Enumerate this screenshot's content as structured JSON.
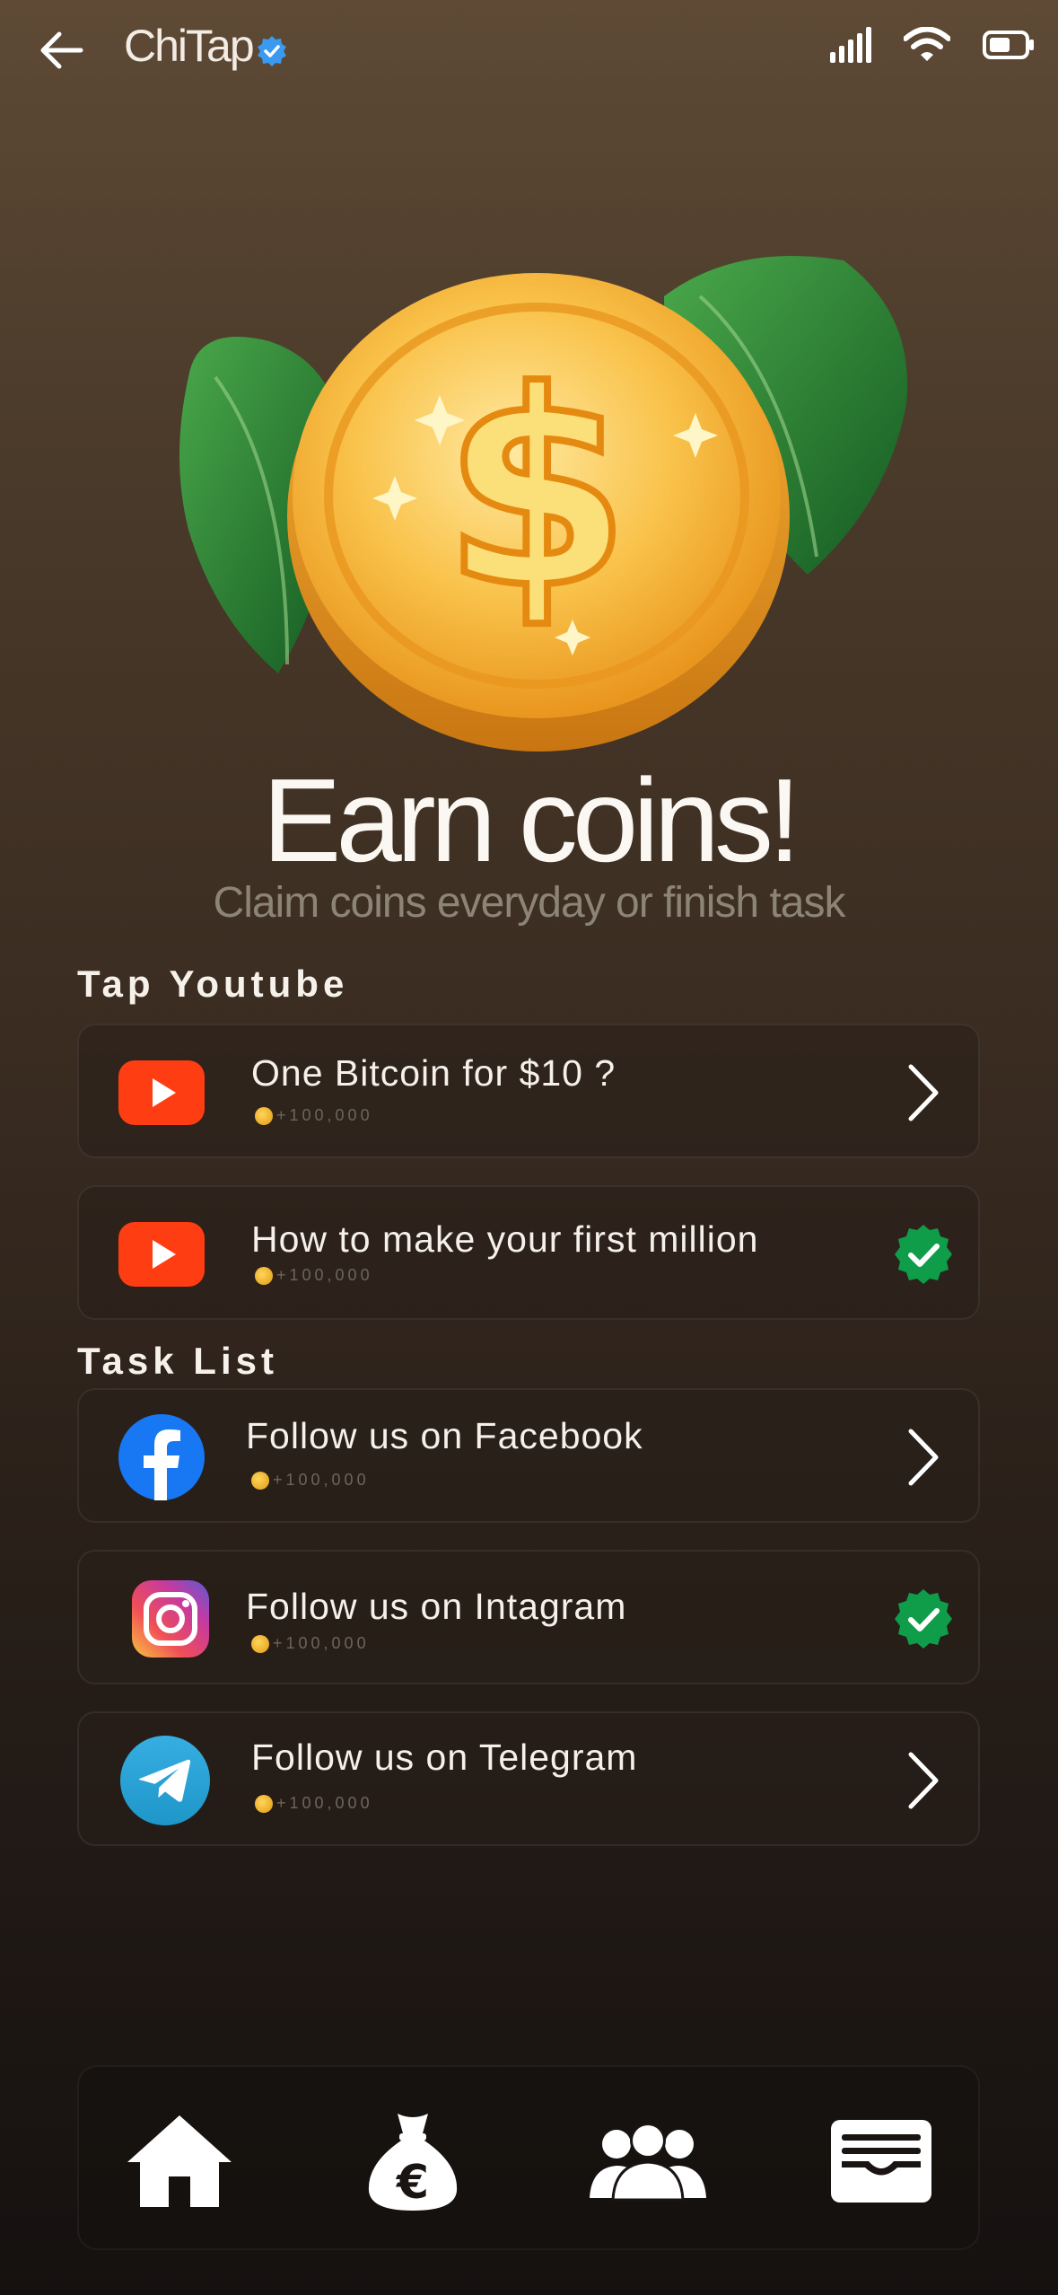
{
  "header": {
    "app_title": "ChiTap",
    "back_icon": "arrow-left-icon",
    "verified_icon": "verified-badge-icon",
    "status_icons": [
      "signal-icon",
      "wifi-icon",
      "battery-icon"
    ]
  },
  "hero": {
    "image": "gold-dollar-coin-with-leaves",
    "headline": "Earn coins!",
    "subline": "Claim coins everyday or finish task"
  },
  "sections": {
    "youtube_title": "Tap Youtube",
    "tasks_title": "Task List"
  },
  "youtube_tasks": [
    {
      "title": "One Bitcoin for $10 ?",
      "reward": "+100,000",
      "icon": "youtube-icon",
      "status": "pending"
    },
    {
      "title": "How to make your first million",
      "reward": "+100,000",
      "icon": "youtube-icon",
      "status": "done"
    }
  ],
  "tasks": [
    {
      "title": "Follow us on Facebook",
      "reward": "+100,000",
      "icon": "facebook-icon",
      "status": "pending"
    },
    {
      "title": "Follow us on Intagram",
      "reward": "+100,000",
      "icon": "instagram-icon",
      "status": "done"
    },
    {
      "title": "Follow us on Telegram",
      "reward": "+100,000",
      "icon": "telegram-icon",
      "status": "pending"
    }
  ],
  "bottom_nav": {
    "items": [
      "home-icon",
      "money-bag-euro-icon",
      "friends-icon",
      "wallet-icon"
    ]
  },
  "colors": {
    "youtube_red": "#ff3d12",
    "facebook_blue": "#1877f2",
    "telegram_blue": "#2aa3e6",
    "done_green": "#0f9d4a",
    "verified_blue": "#3a9af0"
  }
}
